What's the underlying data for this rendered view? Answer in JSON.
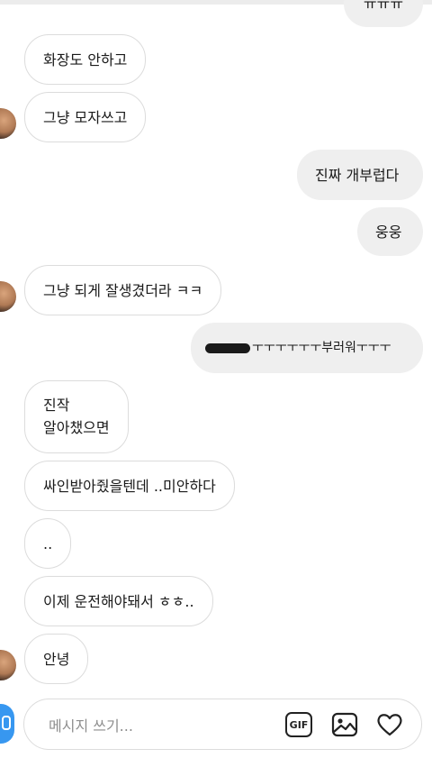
{
  "thread": {
    "messages": [
      {
        "side": "out",
        "text": "ㅠㅠㅠ"
      },
      {
        "side": "in",
        "text": "화장도 안하고"
      },
      {
        "side": "in",
        "text": "그냥 모자쓰고"
      },
      {
        "side": "out",
        "text": "진짜 개부럽다"
      },
      {
        "side": "out",
        "text": "웅웅"
      },
      {
        "side": "in",
        "text": "그냥 되게 잘생겼더라 ㅋㅋ"
      },
      {
        "side": "out",
        "text": "ㅜㅜㅜㅜㅜㅜ부러워ㅜㅜㅜ"
      },
      {
        "side": "in",
        "line1": "진작",
        "line2": "알아챘으면"
      },
      {
        "side": "in",
        "text": "싸인받아줬을텐데 ..미안하다"
      },
      {
        "side": "in",
        "text": ".."
      },
      {
        "side": "in",
        "text": "이제 운전해야돼서 ㅎㅎ.."
      },
      {
        "side": "in",
        "text": "안녕"
      }
    ]
  },
  "composer": {
    "placeholder": "메시지 쓰기...",
    "gif_label": "GIF"
  },
  "colors": {
    "outgoing_bubble": "#efefef",
    "incoming_border": "#dcdcdc",
    "accent": "#3797f0"
  },
  "icons": [
    "camera-icon",
    "gif-icon",
    "image-icon",
    "heart-icon"
  ]
}
